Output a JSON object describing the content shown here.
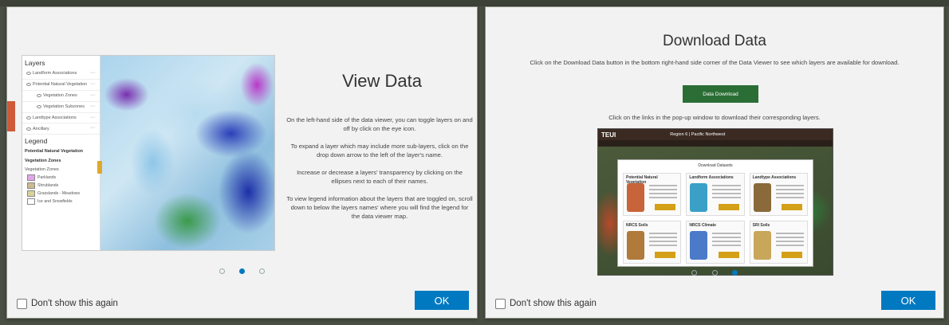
{
  "slide1": {
    "title": "View Data",
    "paragraphs": [
      "On the left-hand side of the data viewer, you can toggle layers on and off by click on the eye icon.",
      "To expand a layer which may include more sub-layers, click on the drop down arrow to the left of the layer's name.",
      "Increase or decrease a layers' transparency by clicking on the ellipses next to each of their names.",
      "To view legend information about the layers that are toggled on, scroll down to below the layers names' where you will find the legend for the data viewer map."
    ],
    "thumbnail": {
      "layers_title": "Layers",
      "layers": [
        {
          "label": "Landform Associations",
          "sub": false
        },
        {
          "label": "Potential Natural Vegetation",
          "sub": false
        },
        {
          "label": "Vegetation Zones",
          "sub": true
        },
        {
          "label": "Vegetation Subzones",
          "sub": true
        },
        {
          "label": "Landtype Associations",
          "sub": false
        },
        {
          "label": "Ancillary",
          "sub": false
        }
      ],
      "legend_title": "Legend",
      "legend_layer": "Potential Natural Vegetation",
      "legend_group": "Vegetation Zones",
      "legend_sub": "Vegetation Zones",
      "legend_items": [
        {
          "label": "Parklands",
          "color": "#e2a6e8"
        },
        {
          "label": "Shrublands",
          "color": "#cbb98f"
        },
        {
          "label": "Grasslands - Meadows",
          "color": "#d8d29a"
        },
        {
          "label": "Ice and Snowfields",
          "color": "#ffffff"
        }
      ]
    }
  },
  "slide2": {
    "title": "Download Data",
    "intro": "Click on the Download Data button in the bottom right-hand side corner of the Data Viewer to see which layers are available for download.",
    "button_label": "Data Download",
    "instruction": "Click on the links in the pop-up window to download their corresponding layers.",
    "screenshot": {
      "logo": "TEUI",
      "header_title": "Region 6 | Pacific Northwest",
      "modal_title": "Download Datasets",
      "cards": [
        {
          "title": "Potential Natural Vegetation",
          "color": "#c8643a"
        },
        {
          "title": "Landform Associations",
          "color": "#3aa0c8"
        },
        {
          "title": "Landtype Associations",
          "color": "#8a6a3a"
        },
        {
          "title": "NRCS Soils",
          "color": "#b07a3a"
        },
        {
          "title": "NRCS Climate",
          "color": "#4a7ac8"
        },
        {
          "title": "SRI Soils",
          "color": "#c8a65a"
        }
      ]
    }
  },
  "common": {
    "dont_show_label": "Don't show this again",
    "ok_label": "OK"
  },
  "pagination": {
    "count": 3,
    "slide1_active": 1,
    "slide2_active": 2
  },
  "colors": {
    "accent": "#0079c1",
    "download_button": "#2b6e35"
  }
}
